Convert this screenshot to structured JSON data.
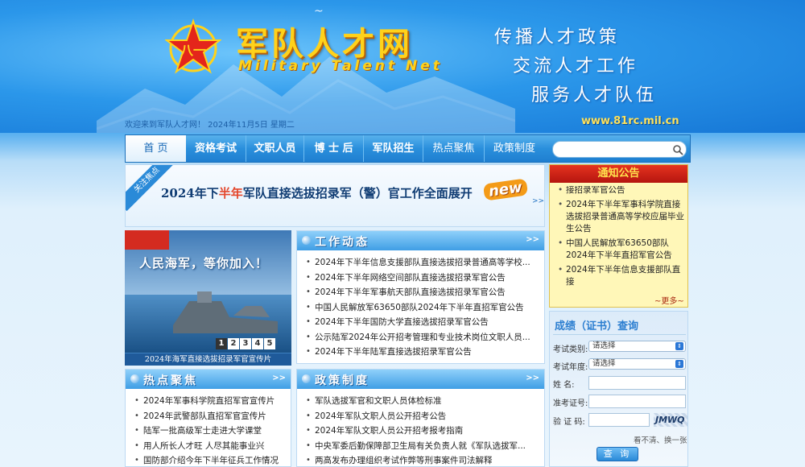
{
  "header": {
    "logo_title": "军队人才网",
    "logo_sub": "Military Talent Net",
    "slogans": [
      "传播人才政策",
      "交流人才工作",
      "服务人才队伍"
    ],
    "welcome": "欢迎来到军队人才网！ 2024年11月5日 星期二",
    "url": "www.81rc.mil.cn"
  },
  "nav": {
    "items": [
      "首 页",
      "资格考试",
      "文职人员",
      "博 士 后",
      "军队招生",
      "热点聚焦",
      "政策制度"
    ],
    "search_placeholder": ""
  },
  "banner": {
    "corner": "关注焦点",
    "text_a": "2024年下",
    "text_hl": "半年",
    "text_b": "军队直接选拔招录军（警）官工作全面展开",
    "badge": "new",
    "more": ">>"
  },
  "announce": {
    "title": "通知公告",
    "items": [
      "接招录军官公告",
      "2024年下半年军事科学院直接选拔招录普通高等学校应届毕业生公告",
      "中国人民解放军63650部队2024年下半年直招军官公告",
      "2024年下半年信息支援部队直接"
    ],
    "more": "更多"
  },
  "video": {
    "slogan": "人民海军，等你加入！",
    "pages": [
      "1",
      "2",
      "3",
      "4",
      "5"
    ],
    "caption": "2024年海军直接选拔招录军官宣传片"
  },
  "work": {
    "title": "工作动态",
    "more": ">>",
    "items": [
      "2024年下半年信息支援部队直接选拔招录普通高等学校...",
      "2024年下半年网络空间部队直接选拔招录军官公告",
      "2024年下半年军事航天部队直接选拔招录军官公告",
      "中国人民解放军63650部队2024年下半年直招军官公告",
      "2024年下半年国防大学直接选拔招录军官公告",
      "公示陆军2024年公开招考管理和专业技术岗位文职人员...",
      "2024年下半年陆军直接选拔招录军官公告"
    ]
  },
  "hot": {
    "title": "热点聚焦",
    "more": ">>",
    "items": [
      "2024年军事科学院直招军官宣传片",
      "2024年武警部队直招军官宣传片",
      "陆军一批高级军士走进大学课堂",
      "用人所长人才旺 人尽其能事业兴",
      "国防部介绍今年下半年征兵工作情况"
    ]
  },
  "policy": {
    "title": "政策制度",
    "more": ">>",
    "items": [
      "军队选拔军官和文职人员体检标准",
      "2024年军队文职人员公开招考公告",
      "2024年军队文职人员公开招考报考指南",
      "中央军委后勤保障部卫生局有关负责人就《军队选拔军...",
      "两高发布办理组织考试作弊等刑事案件司法解释"
    ]
  },
  "query": {
    "title": "成绩（证书）查询",
    "type_label": "考试类别:",
    "type_value": "请选择",
    "year_label": "考试年度:",
    "year_value": "请选择",
    "name_label": "姓 名:",
    "ticket_label": "准考证号:",
    "code_label": "验 证 码:",
    "captcha": "JMWQ",
    "refresh": "看不清、换一张",
    "button": "查 询"
  }
}
